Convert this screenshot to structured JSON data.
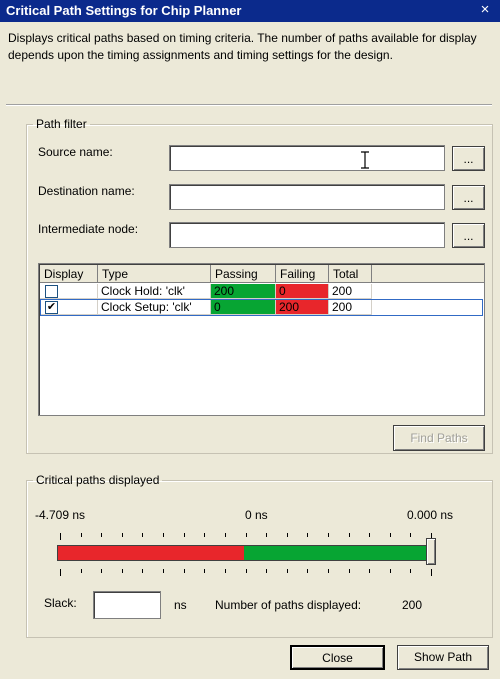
{
  "window": {
    "title": "Critical Path Settings for Chip Planner",
    "close_glyph": "×"
  },
  "description": "Displays critical paths based on timing criteria. The number of paths available for display depends upon the timing assignments and timing settings for the design.",
  "path_filter": {
    "legend": "Path filter",
    "source_label": "Source name:",
    "source_value": "",
    "destination_label": "Destination name:",
    "destination_value": "",
    "intermediate_label": "Intermediate node:",
    "intermediate_value": "",
    "browse_label": "..."
  },
  "table": {
    "columns": [
      "Display",
      "Type",
      "Passing",
      "Failing",
      "Total"
    ],
    "rows": [
      {
        "display": "",
        "type": "Clock Hold: 'clk'",
        "passing": "200",
        "failing": "0",
        "total": "200",
        "checked": false
      },
      {
        "display": "✔",
        "type": "Clock Setup: 'clk'",
        "passing": "0",
        "failing": "200",
        "total": "200",
        "checked": true
      }
    ],
    "colors": {
      "passing": "#07a533",
      "failing": "#e8262b"
    }
  },
  "find_paths_label": "Find Paths",
  "critical": {
    "legend": "Critical paths displayed",
    "left_label": "-4.709 ns",
    "mid_label": "0 ns",
    "right_label": "0.000 ns",
    "slider_fraction": 1.0,
    "zero_fraction": 0.505,
    "slack_label": "Slack:",
    "slack_value": "",
    "slack_unit": "ns",
    "count_label": "Number of paths displayed:",
    "count_value": "200"
  },
  "buttons": {
    "close": "Close",
    "show_path": "Show Path"
  }
}
